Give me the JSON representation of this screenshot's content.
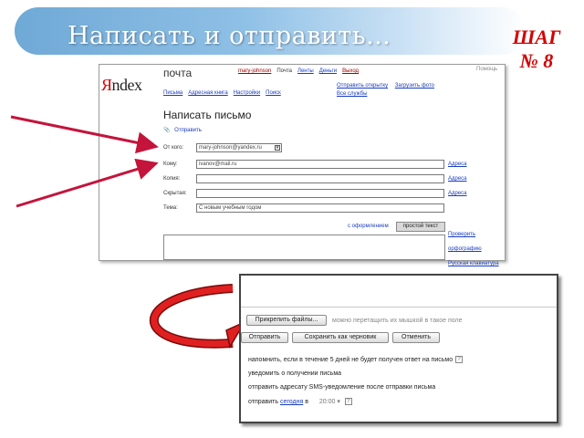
{
  "slide": {
    "title": "Написать  и  отправить…",
    "step_line1": "ШАГ",
    "step_line2": "№ 8"
  },
  "compose_screen": {
    "logo_ya": "Я",
    "logo_rest": "ndex",
    "service": "почта",
    "top_nav": {
      "user": "mary-johnson",
      "items": [
        "Почта",
        "Ленты",
        "Деньги"
      ],
      "logout": "Выход"
    },
    "top_right": "Помощь",
    "quick_links": [
      "Отправить открытку",
      "Загрузить фото"
    ],
    "all_services": "Все службы",
    "mail_nav": [
      "Письма",
      "Адресная книга",
      "Настройки",
      "Поиск"
    ],
    "heading": "Написать письмо",
    "attach_link": "Отправить",
    "fields": {
      "from_label": "От кого:",
      "from_value": "mary-johnson@yandex.ru",
      "to_label": "Кому:",
      "to_value": "ivanov@mail.ru",
      "cc_label": "Копия:",
      "cc_value": "",
      "bcc_label": "Скрытая:",
      "bcc_value": "",
      "subject_label": "Тема:",
      "subject_value": "С новым учебным годом"
    },
    "address_links": [
      "Адреса",
      "Адреса",
      "Адреса"
    ],
    "formatting_link": "с оформлением",
    "plain_text_button": "простой текст",
    "side_links": [
      "Проверить орфографию",
      "Русская клавиатура"
    ]
  },
  "send_screen": {
    "attach_button": "Прикрепить файлы...",
    "attach_hint": "можно перетащить их мышкой в такое поле",
    "send_button": "Отправить",
    "save_draft_button": "Сохранить как черновик",
    "cancel_button": "Отменить",
    "options": {
      "remind": "напомнить, если в течение 5 дней не будет получен ответ на письмо",
      "notify": "уведомить о получении письма",
      "sms": "отправить адресату SMS-уведомление после отправки письма",
      "send_prefix": "отправить",
      "send_day": "сегодня",
      "send_at": "в",
      "send_time": "20:00"
    },
    "help_glyph": "?"
  },
  "colors": {
    "banner": "#8fc0e6",
    "step_text": "#d40000",
    "pointer_arrow": "#c4143c",
    "link": "#1a3dc1"
  },
  "icons": [
    "paperclip-icon",
    "chevron-down-icon",
    "help-icon",
    "pointer-arrow",
    "curved-arrow"
  ]
}
